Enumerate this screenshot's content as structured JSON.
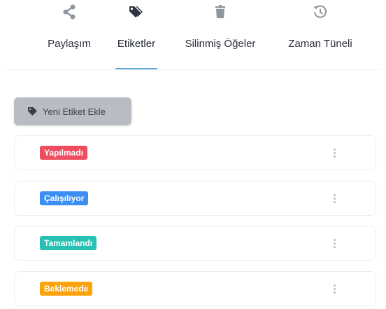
{
  "tabs": [
    {
      "label": "Paylaşım",
      "icon": "share-icon"
    },
    {
      "label": "Etiketler",
      "icon": "tag-icon",
      "active": true
    },
    {
      "label": "Silinmiş Öğeler",
      "icon": "trash-icon"
    },
    {
      "label": "Zaman Tüneli",
      "icon": "history-icon"
    }
  ],
  "add_tag_button": {
    "label": "Yeni Etiket Ekle",
    "icon": "tag-icon"
  },
  "tags": [
    {
      "label": "Yapılmadı",
      "color": "#ee4d5f"
    },
    {
      "label": "Çalışılıyor",
      "color": "#3b8ff3"
    },
    {
      "label": "Tamamlandı",
      "color": "#25c2b3"
    },
    {
      "label": "Beklemede",
      "color": "#fba30e"
    }
  ],
  "colors": {
    "icon_gray": "#8f959e",
    "tab_underline": "#5aa7d8",
    "button_bg": "#b9bcc3"
  }
}
